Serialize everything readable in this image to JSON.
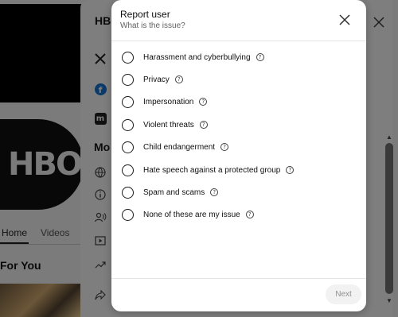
{
  "background": {
    "logo_text": "HBO",
    "tabs": [
      {
        "label": "Home"
      },
      {
        "label": "Videos"
      }
    ],
    "section_title": "For You"
  },
  "about_panel": {
    "title": "HBO",
    "links_heading": "Mo",
    "link_icons": [
      "x-icon",
      "facebook-icon",
      "medium-icon"
    ],
    "info_icons": [
      "globe-icon",
      "info-icon",
      "subscribers-icon",
      "videos-icon",
      "trending-icon",
      "share-icon"
    ]
  },
  "dialog": {
    "title": "Report user",
    "subtitle": "What is the issue?",
    "options": [
      {
        "label": "Harassment and cyberbullying"
      },
      {
        "label": "Privacy"
      },
      {
        "label": "Impersonation"
      },
      {
        "label": "Violent threats"
      },
      {
        "label": "Child endangerment"
      },
      {
        "label": "Hate speech against a protected group"
      },
      {
        "label": "Spam and scams"
      },
      {
        "label": "None of these are my issue"
      }
    ],
    "help_glyph": "?",
    "next_label": "Next"
  },
  "colors": {
    "overlay": "#7b7b7b",
    "dialog_bg": "#ffffff",
    "next_disabled_bg": "#f2f2f2",
    "next_disabled_text": "#909090"
  }
}
